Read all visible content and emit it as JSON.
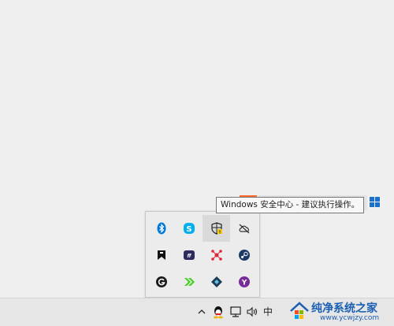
{
  "tooltip": {
    "text": "Windows 安全中心 - 建议执行操作。"
  },
  "tray": {
    "icons": [
      {
        "name": "bluetooth-icon"
      },
      {
        "name": "skype-icon"
      },
      {
        "name": "windows-security-warning-icon"
      },
      {
        "name": "cloud-offline-icon"
      },
      {
        "name": "bookmark-app-icon"
      },
      {
        "name": "chat-app-icon"
      },
      {
        "name": "network-node-app-icon"
      },
      {
        "name": "steam-icon"
      },
      {
        "name": "g-app-icon"
      },
      {
        "name": "green-chevron-app-icon"
      },
      {
        "name": "diamond-app-icon"
      },
      {
        "name": "purple-y-app-icon"
      }
    ]
  },
  "taskbar": {
    "ime_label": "中",
    "icons": [
      "chevron-up-icon",
      "qq-icon",
      "network-icon",
      "volume-icon"
    ]
  },
  "watermark": {
    "title": "纯净系统之家",
    "url": "www.ycwjzy.com"
  },
  "colors": {
    "accent": "#1a5fb4",
    "bluetooth": "#0078d7",
    "skype": "#00aff0",
    "steam": "#1b2838",
    "green": "#3fd11e",
    "purple": "#7a2b9a"
  }
}
